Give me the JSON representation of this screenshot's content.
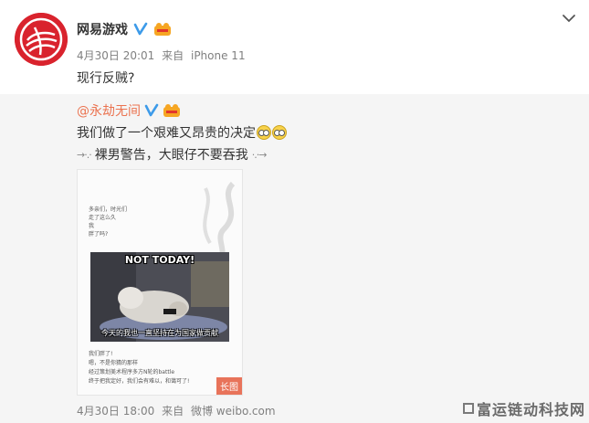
{
  "post": {
    "author": "网易游戏",
    "time": "4月30日 20:01",
    "source_prefix": "来自",
    "source": "iPhone 11",
    "text": "现行反贼?"
  },
  "repost": {
    "author": "@永劫无间",
    "text_line1": "我们做了一个艰难又昂贵的决定",
    "arrow_left": "→·.·",
    "arrow_right": "·.·→",
    "text_line2": "裸男警告，大眼仔不要吞我",
    "image": {
      "lines_top": [
        "多亲们，时光们",
        "走了这么久",
        "我",
        "胖了吗?"
      ],
      "meme_title": "NOT TODAY!",
      "meme_caption": "今天的我也一直坚持在为国家做贡献",
      "lines_bottom": [
        "我们胖了!",
        "嗯，不是你猜的那样",
        "经过策划美术程序多方N轮的battle",
        "终于把我定好，我们会有难以，和蔼可了!"
      ],
      "badge": "长图"
    },
    "time": "4月30日 18:00",
    "source_prefix": "来自",
    "source": "微博 weibo.com"
  },
  "watermark": "富运链动科技网",
  "colors": {
    "brand_red": "#d9232d",
    "link_orange": "#eb7350",
    "verified_blue": "#3d9be9"
  }
}
